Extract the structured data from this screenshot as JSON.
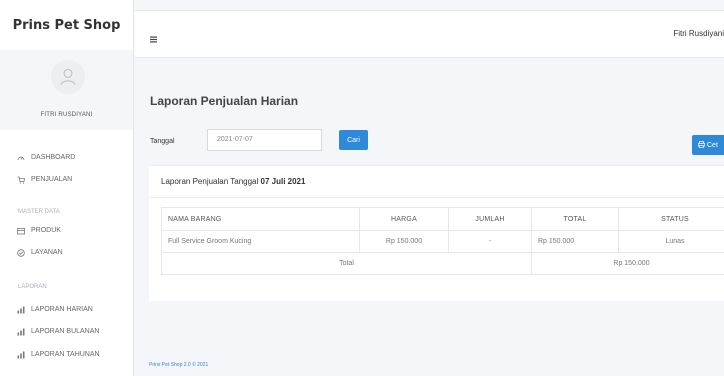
{
  "app": {
    "brand": "Prins Pet Shop"
  },
  "profile": {
    "name": "FITRI RUSDIYANI"
  },
  "sidebar": {
    "items": [
      {
        "label": "DASHBOARD",
        "icon": "dashboard-icon"
      },
      {
        "label": "PENJUALAN",
        "icon": "cart-icon"
      }
    ],
    "master_heading": "MASTER DATA",
    "master_items": [
      {
        "label": "PRODUK",
        "icon": "box-icon"
      },
      {
        "label": "LAYANAN",
        "icon": "service-icon"
      }
    ],
    "report_heading": "LAPORAN",
    "report_items": [
      {
        "label": "LAPORAN HARIAN",
        "icon": "chart-icon"
      },
      {
        "label": "LAPORAN BULANAN",
        "icon": "chart-icon"
      },
      {
        "label": "LAPORAN TAHUNAN",
        "icon": "chart-icon"
      }
    ]
  },
  "topbar": {
    "menu_icon": "hamburger-icon",
    "username": "Fitri Rusdiyani"
  },
  "page": {
    "title": "Laporan Penjualan Harian",
    "date_label": "Tanggal",
    "date_value": "2021-07-07",
    "search_button": "Cari",
    "print_button": "Cet",
    "print_icon": "printer-icon"
  },
  "report": {
    "title_prefix": "Laporan Penjualan Tanggal",
    "title_date": "07 Juli 2021",
    "columns": [
      "NAMA BARANG",
      "HARGA",
      "JUMLAH",
      "TOTAL",
      "STATUS"
    ],
    "rows": [
      {
        "name": "Full Service Groom Kucing",
        "harga": "Rp 150.000",
        "jumlah": "-",
        "total": "Rp 150.000",
        "status": "Lunas"
      }
    ],
    "total_label": "Total",
    "total_value": "Rp 150.000"
  },
  "footer": {
    "text": "Prins Pet Shop 2.0 © 2021"
  },
  "colors": {
    "accent": "#2e8ad8",
    "background": "#f4f6f9"
  }
}
